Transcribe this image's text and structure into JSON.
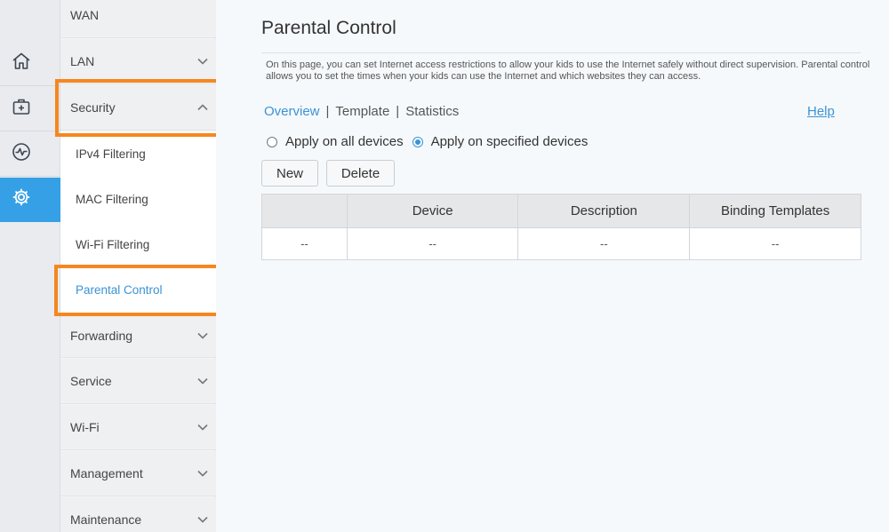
{
  "rail": {
    "items": [
      {
        "icon": "home-icon"
      },
      {
        "icon": "medical-kit-icon"
      },
      {
        "icon": "pulse-icon"
      },
      {
        "icon": "gear-icon",
        "active": true
      }
    ],
    "active_color": "#35a0e6"
  },
  "menu": {
    "items": [
      {
        "label": "WAN",
        "expandable": false
      },
      {
        "label": "LAN",
        "expandable": true
      },
      {
        "label": "Security",
        "expanded": true
      },
      {
        "label": "IPv4 Filtering",
        "sub": true
      },
      {
        "label": "MAC Filtering",
        "sub": true
      },
      {
        "label": "Wi-Fi Filtering",
        "sub": true
      },
      {
        "label": "Parental Control",
        "sub": true,
        "active": true
      },
      {
        "label": "Forwarding",
        "expandable": true
      },
      {
        "label": "Service",
        "expandable": true
      },
      {
        "label": "Wi-Fi",
        "expandable": true
      },
      {
        "label": "Management",
        "expandable": true
      },
      {
        "label": "Maintenance",
        "expandable": true
      }
    ],
    "highlight_color": "#f5871f"
  },
  "main": {
    "title": "Parental Control",
    "description": "On this page, you can set Internet access restrictions to allow your kids to use the Internet safely without direct supervision. Parental control allows you to set the times when your kids can use the Internet and which websites they can access.",
    "tabs": [
      {
        "label": "Overview",
        "active": true
      },
      {
        "label": "Template"
      },
      {
        "label": "Statistics"
      }
    ],
    "help_label": "Help",
    "radios": [
      {
        "label": "Apply on all devices",
        "checked": false
      },
      {
        "label": "Apply on specified devices",
        "checked": true
      }
    ],
    "buttons": {
      "new": "New",
      "delete": "Delete"
    },
    "table": {
      "headers": [
        "",
        "Device",
        "Description",
        "Binding Templates"
      ],
      "rows": [
        [
          "--",
          "--",
          "--",
          "--"
        ]
      ]
    },
    "accent_color": "#3a93d4"
  }
}
